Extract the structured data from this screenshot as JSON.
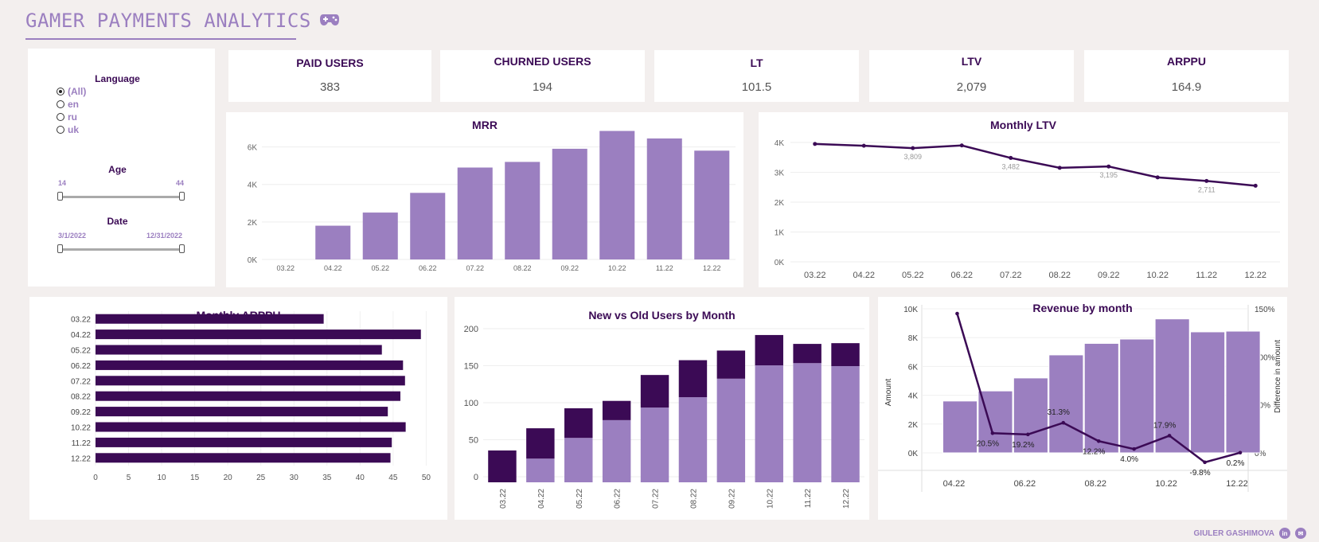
{
  "header": {
    "title": "GAMER PAYMENTS ANALYTICS",
    "icon": "gamepad-icon"
  },
  "filters": {
    "language_label": "Language",
    "language_options": [
      "(All)",
      "en",
      "ru",
      "uk"
    ],
    "language_selected": "(All)",
    "age_label": "Age",
    "age_min": "14",
    "age_max": "44",
    "date_label": "Date",
    "date_min": "3/1/2022",
    "date_max": "12/31/2022"
  },
  "kpis": [
    {
      "title": "PAID USERS",
      "value": "383"
    },
    {
      "title": "CHURNED USERS",
      "value": "194"
    },
    {
      "title": "LT",
      "value": "101.5"
    },
    {
      "title": "LTV",
      "value": "2,079"
    },
    {
      "title": "ARPPU",
      "value": "164.9"
    }
  ],
  "chart_data": [
    {
      "type": "bar",
      "title": "MRR",
      "categories": [
        "03.22",
        "04.22",
        "05.22",
        "06.22",
        "07.22",
        "08.22",
        "09.22",
        "10.22",
        "11.22",
        "12.22"
      ],
      "values": [
        0,
        1800,
        2500,
        3550,
        4900,
        5200,
        5900,
        6850,
        6450,
        5800
      ],
      "yticks": [
        "0K",
        "2K",
        "4K",
        "6K"
      ],
      "ylim": [
        0,
        7000
      ]
    },
    {
      "type": "line",
      "title": "Monthly LTV",
      "categories": [
        "03.22",
        "04.22",
        "05.22",
        "06.22",
        "07.22",
        "08.22",
        "09.22",
        "10.22",
        "11.22",
        "12.22"
      ],
      "values": [
        3950,
        3890,
        3809,
        3900,
        3482,
        3150,
        3195,
        2830,
        2711,
        2550
      ],
      "data_labels": {
        "2": "3,809",
        "4": "3,482",
        "6": "3,195",
        "8": "2,711"
      },
      "yticks": [
        "0K",
        "1K",
        "2K",
        "3K",
        "4K"
      ],
      "ylim": [
        0,
        4000
      ]
    },
    {
      "type": "bar",
      "orientation": "horizontal",
      "title": "Monthly ARPPU",
      "categories": [
        "03.22",
        "04.22",
        "05.22",
        "06.22",
        "07.22",
        "08.22",
        "09.22",
        "10.22",
        "11.22",
        "12.22"
      ],
      "values": [
        34.5,
        49.2,
        43.3,
        46.5,
        46.8,
        46.1,
        44.2,
        46.9,
        44.8,
        44.6
      ],
      "xticks": [
        "0",
        "5",
        "10",
        "15",
        "20",
        "25",
        "30",
        "35",
        "40",
        "45",
        "50"
      ],
      "xlim": [
        0,
        52
      ]
    },
    {
      "type": "bar",
      "stacked": true,
      "title": "New vs Old Users by Month",
      "categories": [
        "03.22",
        "04.22",
        "05.22",
        "06.22",
        "07.22",
        "08.22",
        "09.22",
        "10.22",
        "11.22",
        "12.22"
      ],
      "series": [
        {
          "values": [
            0,
            32,
            60,
            84,
            101,
            115,
            140,
            158,
            161,
            157
          ]
        },
        {
          "values": [
            43,
            41,
            40,
            26,
            44,
            50,
            38,
            41,
            26,
            31
          ]
        }
      ],
      "yticks": [
        "0",
        "50",
        "100",
        "150",
        "200"
      ],
      "ylim": [
        0,
        200
      ]
    },
    {
      "type": "bar",
      "title": "Revenue by month",
      "ylabel": "Amount",
      "ylabel_right": "Difference in amount",
      "categories": [
        "03.22",
        "04.22",
        "05.22",
        "06.22",
        "07.22",
        "08.22",
        "09.22",
        "10.22",
        "11.22",
        "12.22"
      ],
      "xtick_labels": [
        "04.22",
        "06.22",
        "08.22",
        "10.22",
        "12.22"
      ],
      "values": [
        0,
        3600,
        4300,
        5200,
        6800,
        7600,
        7900,
        9300,
        8400,
        8450
      ],
      "line_values": [
        null,
        145,
        20.5,
        19.2,
        31.3,
        12.2,
        4.0,
        17.9,
        -9.8,
        0.2
      ],
      "line_labels": [
        "20.5%",
        "19.2%",
        "31.3%",
        "12.2%",
        "4.0%",
        "17.9%",
        "-9.8%",
        "0.2%"
      ],
      "yticks": [
        "0K",
        "2K",
        "4K",
        "6K",
        "8K",
        "10K"
      ],
      "yticks_right": [
        "0%",
        "50%",
        "100%",
        "150%"
      ],
      "ylim": [
        0,
        10000
      ],
      "ylim_right": [
        -20,
        150
      ]
    }
  ],
  "footer": {
    "author": "GIULER GASHIMOVA",
    "icons": [
      "linkedin-icon",
      "email-icon"
    ]
  },
  "colors": {
    "dark": "#3b0a55",
    "light": "#9b7fc0",
    "bg": "#f3efee"
  }
}
